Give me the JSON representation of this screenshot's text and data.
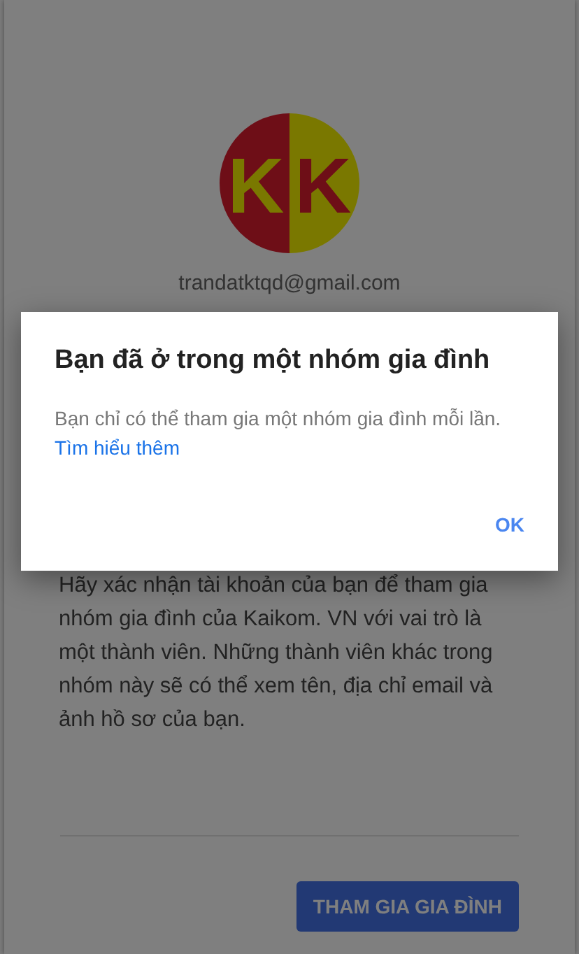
{
  "account": {
    "avatar": {
      "kind": "logo",
      "letters": [
        "K",
        "K"
      ]
    },
    "email": "trandatktqd@gmail.com"
  },
  "message": "Hãy xác nhận tài khoản của bạn để tham gia nhóm gia đình của Kaikom. VN với vai trò là một thành viên. Những thành viên khác trong nhóm này sẽ có thể xem tên, địa chỉ email và ảnh hồ sơ của bạn.",
  "join_button": "THAM GIA GIA ĐÌNH",
  "dialog": {
    "title": "Bạn đã ở trong một nhóm gia đình",
    "body": "Bạn chỉ có thể tham gia một nhóm gia đình mỗi lần.",
    "link": "Tìm hiểu thêm",
    "button": "OK"
  }
}
